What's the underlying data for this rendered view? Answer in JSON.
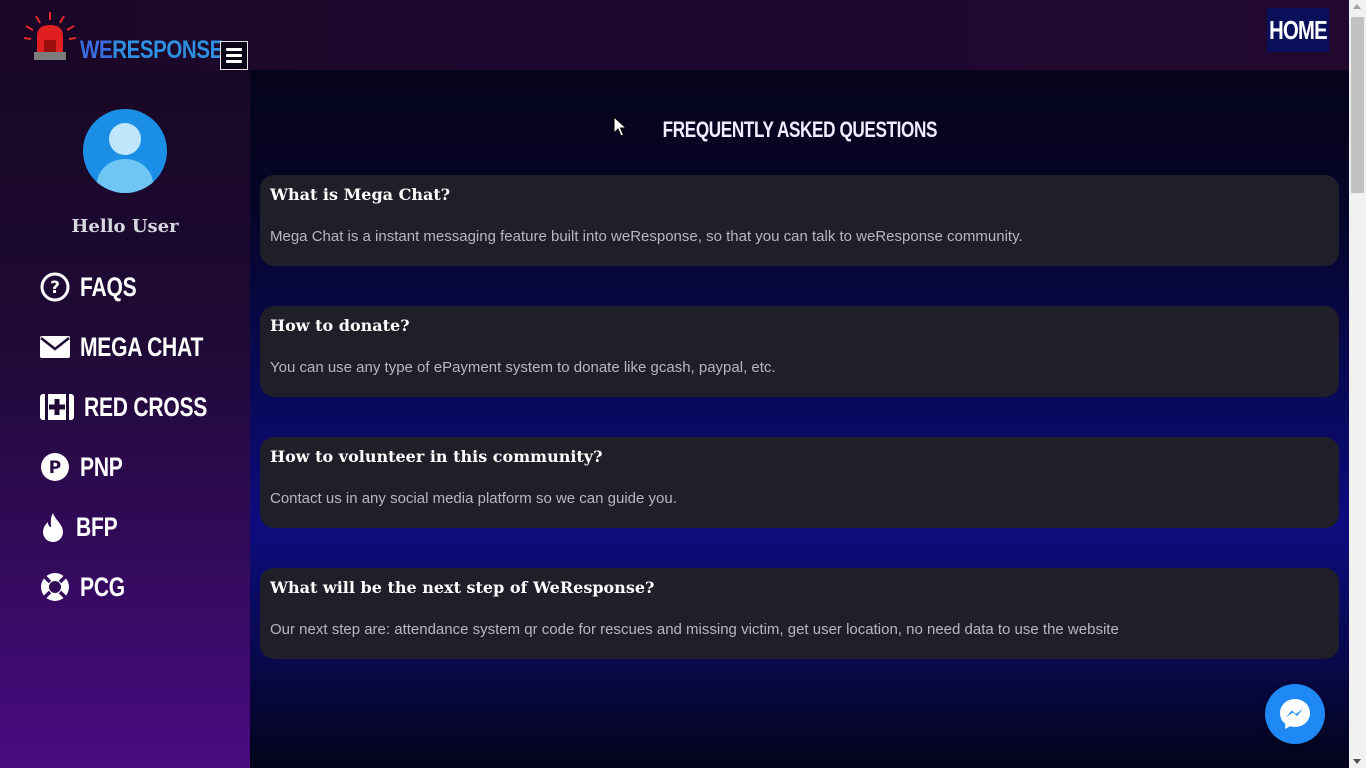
{
  "header": {
    "logo_prefix": "WE",
    "logo_suffix": "RESPONSE",
    "home_label": "HOME"
  },
  "sidebar": {
    "greeting": "Hello User",
    "items": [
      {
        "label": "FAQS",
        "icon": "question-circle-icon"
      },
      {
        "label": "MEGA CHAT",
        "icon": "envelope-icon"
      },
      {
        "label": "RED CROSS",
        "icon": "medical-kit-icon"
      },
      {
        "label": "PNP",
        "icon": "parking-circle-icon"
      },
      {
        "label": "BFP",
        "icon": "fire-icon"
      },
      {
        "label": "PCG",
        "icon": "life-ring-icon"
      }
    ]
  },
  "main": {
    "title": "FREQUENTLY ASKED QUESTIONS",
    "faqs": [
      {
        "question": "What is Mega Chat?",
        "answer": "Mega Chat is a instant messaging feature built into weResponse, so that you can talk to weResponse community."
      },
      {
        "question": "How to donate?",
        "answer": "You can use any type of ePayment system to donate like gcash, paypal, etc."
      },
      {
        "question": "How to volunteer in this community?",
        "answer": "Contact us in any social media platform so we can guide you."
      },
      {
        "question": "What will be the next step of WeResponse?",
        "answer": "Our next step are: attendance system qr code for rescues and missing victim, get user location, no need data to use the website"
      }
    ]
  },
  "colors": {
    "accent_blue": "#1e88f5",
    "home_bg": "#0a0f5c",
    "card_bg": "#1f1f29"
  }
}
